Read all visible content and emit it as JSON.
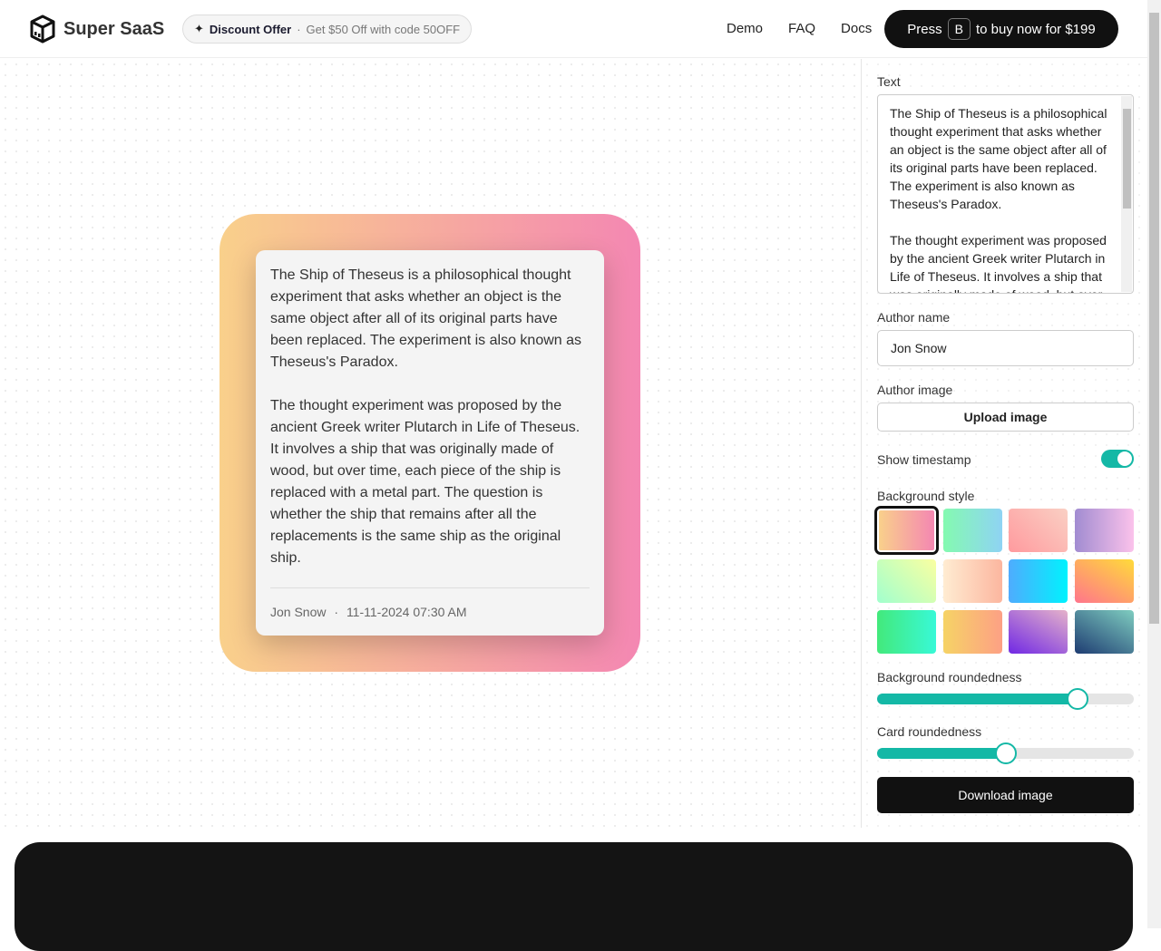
{
  "nav": {
    "brand": "Super SaaS",
    "promo_title": "Discount Offer",
    "promo_sep": "·",
    "promo_text": "Get $50 Off with code 50OFF",
    "links": [
      "Demo",
      "FAQ",
      "Docs"
    ],
    "buy_pre": "Press",
    "buy_key": "B",
    "buy_post": "to buy now for $199"
  },
  "card": {
    "text": "The Ship of Theseus is a philosophical thought experiment that asks whether an object is the same object after all of its original parts have been replaced. The experiment is also known as Theseus's Paradox.\n\nThe thought experiment was proposed by the ancient Greek writer Plutarch in Life of Theseus. It involves a ship that was originally made of wood, but over time, each piece of the ship is replaced with a metal part. The question is whether the ship that remains after all the replacements is the same ship as the original ship.",
    "author": "Jon Snow",
    "sep": "·",
    "timestamp": "11-11-2024 07:30 AM"
  },
  "panel": {
    "text_label": "Text",
    "author_label": "Author name",
    "author_value": "Jon Snow",
    "image_label": "Author image",
    "upload_label": "Upload image",
    "timestamp_label": "Show timestamp",
    "timestamp_on": true,
    "bg_label": "Background style",
    "selected_bg": 0,
    "swatches": [
      "linear-gradient(90deg,#f9d08b,#f487b2)",
      "linear-gradient(90deg,#84fab0,#8fd3f4)",
      "linear-gradient(45deg,#ff9a9e,#fad0c4)",
      "linear-gradient(90deg,#a18cd1,#fbc2eb)",
      "linear-gradient(45deg,#a1ffce,#faffa1)",
      "linear-gradient(90deg,#ffecd2,#fcb69f)",
      "linear-gradient(90deg,#4facfe,#00f2fe)",
      "linear-gradient(30deg,#ff758c,#ffdb3a)",
      "linear-gradient(90deg,#43e97b,#38f9d7)",
      "linear-gradient(90deg,#f6d365,#fda085)",
      "linear-gradient(30deg,#7028e4,#e5b2ca)",
      "linear-gradient(30deg,#1e3c72,#7fcdc0)"
    ],
    "bg_round_label": "Background roundedness",
    "bg_round": 0.78,
    "card_round_label": "Card roundedness",
    "card_round": 0.5,
    "download_label": "Download image"
  },
  "accent": "#14b8a6"
}
